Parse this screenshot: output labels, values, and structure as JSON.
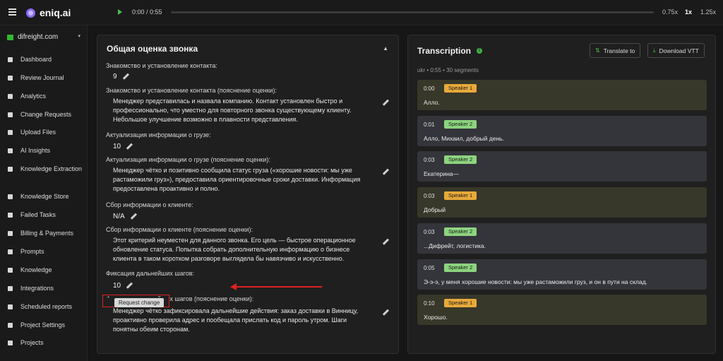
{
  "app": {
    "name": "eniq.ai",
    "brand_color": "#8a6bff"
  },
  "player": {
    "time": "0:00 / 0:55",
    "progress": 0,
    "speeds": [
      "0.75x",
      "1x",
      "1.25x"
    ],
    "active_speed": "1x"
  },
  "sidebar": {
    "org": "difreight.com",
    "items": [
      {
        "label": "Dashboard",
        "icon": "dashboard-icon"
      },
      {
        "label": "Review Journal",
        "icon": "journal-icon"
      },
      {
        "label": "Analytics",
        "icon": "analytics-icon"
      },
      {
        "label": "Change Requests",
        "icon": "pencil-icon"
      },
      {
        "label": "Upload Files",
        "icon": "upload-icon"
      },
      {
        "label": "AI Insights",
        "icon": "sparkle-icon"
      },
      {
        "label": "Knowledge Extraction",
        "icon": "book-icon"
      },
      {
        "label": "Knowledge Store",
        "icon": "book-icon"
      },
      {
        "label": "Failed Tasks",
        "icon": "warning-icon"
      },
      {
        "label": "Billing & Payments",
        "icon": "bank-icon"
      },
      {
        "label": "Prompts",
        "icon": "document-icon"
      },
      {
        "label": "Knowledge",
        "icon": "book-icon"
      },
      {
        "label": "Integrations",
        "icon": "sync-icon"
      },
      {
        "label": "Scheduled reports",
        "icon": "clock-icon"
      },
      {
        "label": "Project Settings",
        "icon": "sliders-icon"
      },
      {
        "label": "Projects",
        "icon": "folder-icon"
      }
    ]
  },
  "evaluation": {
    "title": "Общая оценка звонка",
    "fields": [
      {
        "label": "Знакомство и установление контакта:",
        "value": "9"
      },
      {
        "label": "Знакомство и установление контакта (пояснение оценки):",
        "text": "Менеджер представилась и назвала компанию. Контакт установлен быстро и профессионально, что уместно для повторного звонка существующему клиенту. Небольшое улучшение возможно в плавности представления."
      },
      {
        "label": "Актуализация информации о грузе:",
        "value": "10"
      },
      {
        "label": "Актуализация информации о грузе (пояснение оценки):",
        "text": "Менеджер чётко и позитивно сообщила статус груза («хорошие новости: мы уже растаможили груз»), предоставила ориентировочные сроки доставки. Информация предоставлена проактивно и полно."
      },
      {
        "label": "Сбор информации о клиенте:",
        "value": "N/A"
      },
      {
        "label": "Сбор информации о клиенте (пояснение оценки):",
        "text": "Этот критерий неуместен для данного звонка. Его цель — быстрое операционное обновление статуса. Попытка собрать дополнительную информацию о бизнесе клиента в таком коротком разговоре выглядела бы навязчиво и искусственно."
      },
      {
        "label": "Фиксация дальнейших шагов:",
        "value": "10"
      },
      {
        "label": "Фиксация дальнейших шагов (пояснение оценки):",
        "text": "Менеджер чётко зафиксировала дальнейшие действия: заказ доставки в Винницу, проактивно проверила адрес и пообещала прислать код и пароль утром. Шаги понятны обеим сторонам."
      }
    ],
    "tooltip": "Request change",
    "annotation_color": "#e02020"
  },
  "transcription": {
    "title": "Transcription",
    "translate_label": "Translate to",
    "download_label": "Download VTT",
    "meta": "ukr • 0:55 • 30 segments",
    "segments": [
      {
        "time": "0:00",
        "speaker": "Speaker 1",
        "text": "Алло."
      },
      {
        "time": "0:01",
        "speaker": "Speaker 2",
        "text": "Алло, Михаил, добрый день."
      },
      {
        "time": "0:03",
        "speaker": "Speaker 2",
        "text": "Екатерина—"
      },
      {
        "time": "0:03",
        "speaker": "Speaker 1",
        "text": "Добрый"
      },
      {
        "time": "0:03",
        "speaker": "Speaker 2",
        "text": "...Дифрейт, логистика."
      },
      {
        "time": "0:05",
        "speaker": "Speaker 2",
        "text": "Э-э-э, у меня хорошие новости: мы уже растаможили груз, и он в пути на склад."
      },
      {
        "time": "0:10",
        "speaker": "Speaker 1",
        "text": "Хорошо."
      }
    ]
  }
}
